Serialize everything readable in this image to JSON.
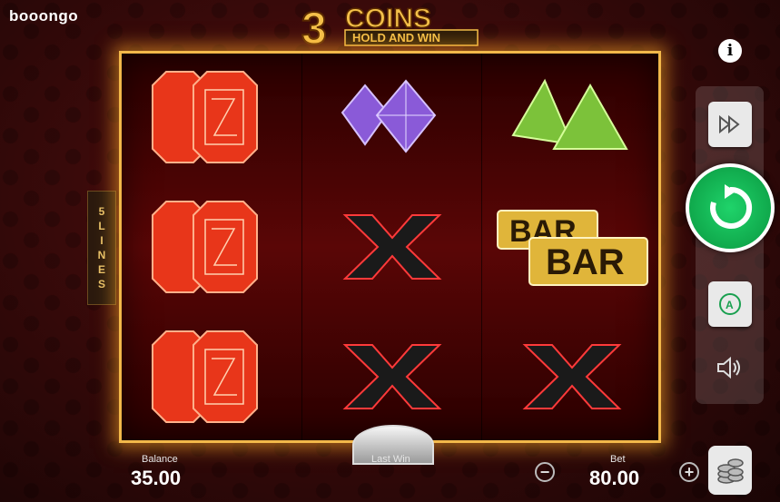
{
  "brand": "booongo",
  "logo": {
    "number": "3",
    "title": "COINS",
    "subtitle": "HOLD AND WIN"
  },
  "lines_indicator": {
    "count": "5",
    "label": [
      "L",
      "I",
      "N",
      "E",
      "S"
    ]
  },
  "reels": [
    [
      "red-gem-double",
      "red-gem-double",
      "red-gem-double"
    ],
    [
      "purple-diamond-double",
      "x-symbol",
      "x-symbol"
    ],
    [
      "green-triangle-double",
      "bar-double",
      "x-symbol"
    ]
  ],
  "bar_text": "BAR",
  "info_button": "i",
  "balance": {
    "label": "Balance",
    "value": "35.00"
  },
  "last_win": {
    "label": "Last Win",
    "value": ""
  },
  "bet": {
    "label": "Bet",
    "value": "80.00"
  },
  "controls": {
    "minus": "−",
    "plus": "+",
    "autoplay_letter": "A"
  },
  "colors": {
    "frame": "#f2b84a",
    "spin": "#10a94c",
    "bar_gold": "#e0b53a"
  }
}
